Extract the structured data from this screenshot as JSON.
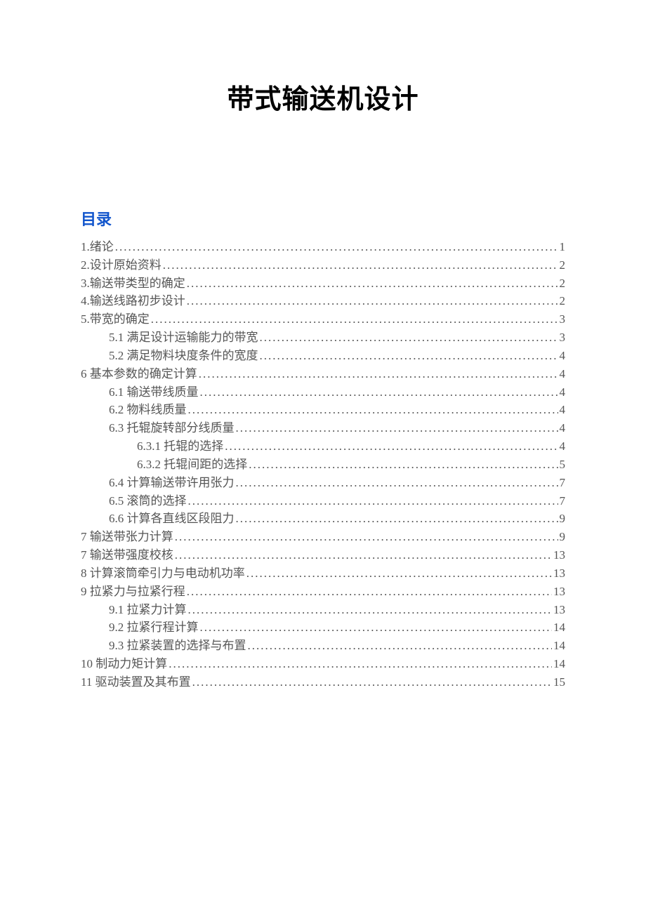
{
  "title": "带式输送机设计",
  "toc_heading": "目录",
  "toc": [
    {
      "level": 1,
      "label": "1.绪论",
      "page": "1"
    },
    {
      "level": 1,
      "label": "2.设计原始资料",
      "page": "2"
    },
    {
      "level": 1,
      "label": "3.输送带类型的确定",
      "page": "2"
    },
    {
      "level": 1,
      "label": "4.输送线路初步设计",
      "page": "2"
    },
    {
      "level": 1,
      "label": "5.带宽的确定",
      "page": "3"
    },
    {
      "level": 2,
      "label": "5.1 满足设计运输能力的带宽",
      "page": "3"
    },
    {
      "level": 2,
      "label": "5.2 满足物料块度条件的宽度",
      "page": "4"
    },
    {
      "level": 1,
      "label": "6 基本参数的确定计算",
      "page": "4"
    },
    {
      "level": 2,
      "label": "6.1 输送带线质量",
      "page": "4"
    },
    {
      "level": 2,
      "label": "6.2 物料线质量",
      "page": "4"
    },
    {
      "level": 2,
      "label": "6.3 托辊旋转部分线质量",
      "page": "4"
    },
    {
      "level": 3,
      "label": "6.3.1 托辊的选择",
      "page": "4"
    },
    {
      "level": 3,
      "label": "6.3.2 托辊间距的选择",
      "page": "5"
    },
    {
      "level": 2,
      "label": "6.4 计算输送带许用张力",
      "page": "7"
    },
    {
      "level": 2,
      "label": "6.5 滚筒的选择",
      "page": "7"
    },
    {
      "level": 2,
      "label": "6.6 计算各直线区段阻力",
      "page": "9"
    },
    {
      "level": 1,
      "label": "7 输送带张力计算",
      "page": "9"
    },
    {
      "level": 1,
      "label": "7 输送带强度校核",
      "page": "13"
    },
    {
      "level": 1,
      "label": "8 计算滚筒牵引力与电动机功率",
      "page": "13"
    },
    {
      "level": 1,
      "label": "9  拉紧力与拉紧行程",
      "page": "13"
    },
    {
      "level": 2,
      "label": "9.1 拉紧力计算",
      "page": "13"
    },
    {
      "level": 2,
      "label": "9.2 拉紧行程计算",
      "page": "14"
    },
    {
      "level": 2,
      "label": "9.3 拉紧装置的选择与布置",
      "page": "14"
    },
    {
      "level": 1,
      "label": "10  制动力矩计算",
      "page": "14"
    },
    {
      "level": 1,
      "label": "11  驱动装置及其布置",
      "page": "15"
    }
  ]
}
